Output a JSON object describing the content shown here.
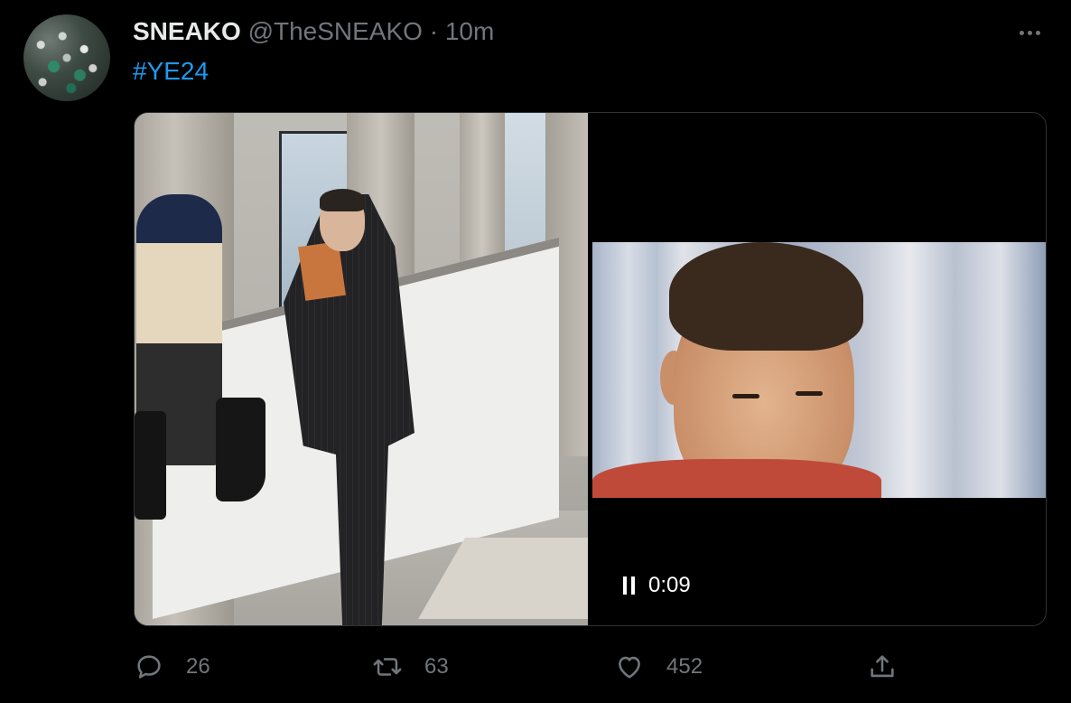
{
  "tweet": {
    "display_name": "SNEAKO",
    "handle": "@TheSNEAKO",
    "separator": "·",
    "time": "10m",
    "hashtag": "#YE24"
  },
  "video": {
    "timestamp": "0:09",
    "state": "playing"
  },
  "actions": {
    "replies": "26",
    "retweets": "63",
    "likes": "452"
  },
  "colors": {
    "background": "#000000",
    "text": "#e7e9ea",
    "muted": "#71767b",
    "link": "#1d9bf0",
    "border": "#2f3336"
  },
  "icons": [
    "more-icon",
    "pause-icon",
    "reply-icon",
    "retweet-icon",
    "like-icon",
    "share-icon"
  ]
}
